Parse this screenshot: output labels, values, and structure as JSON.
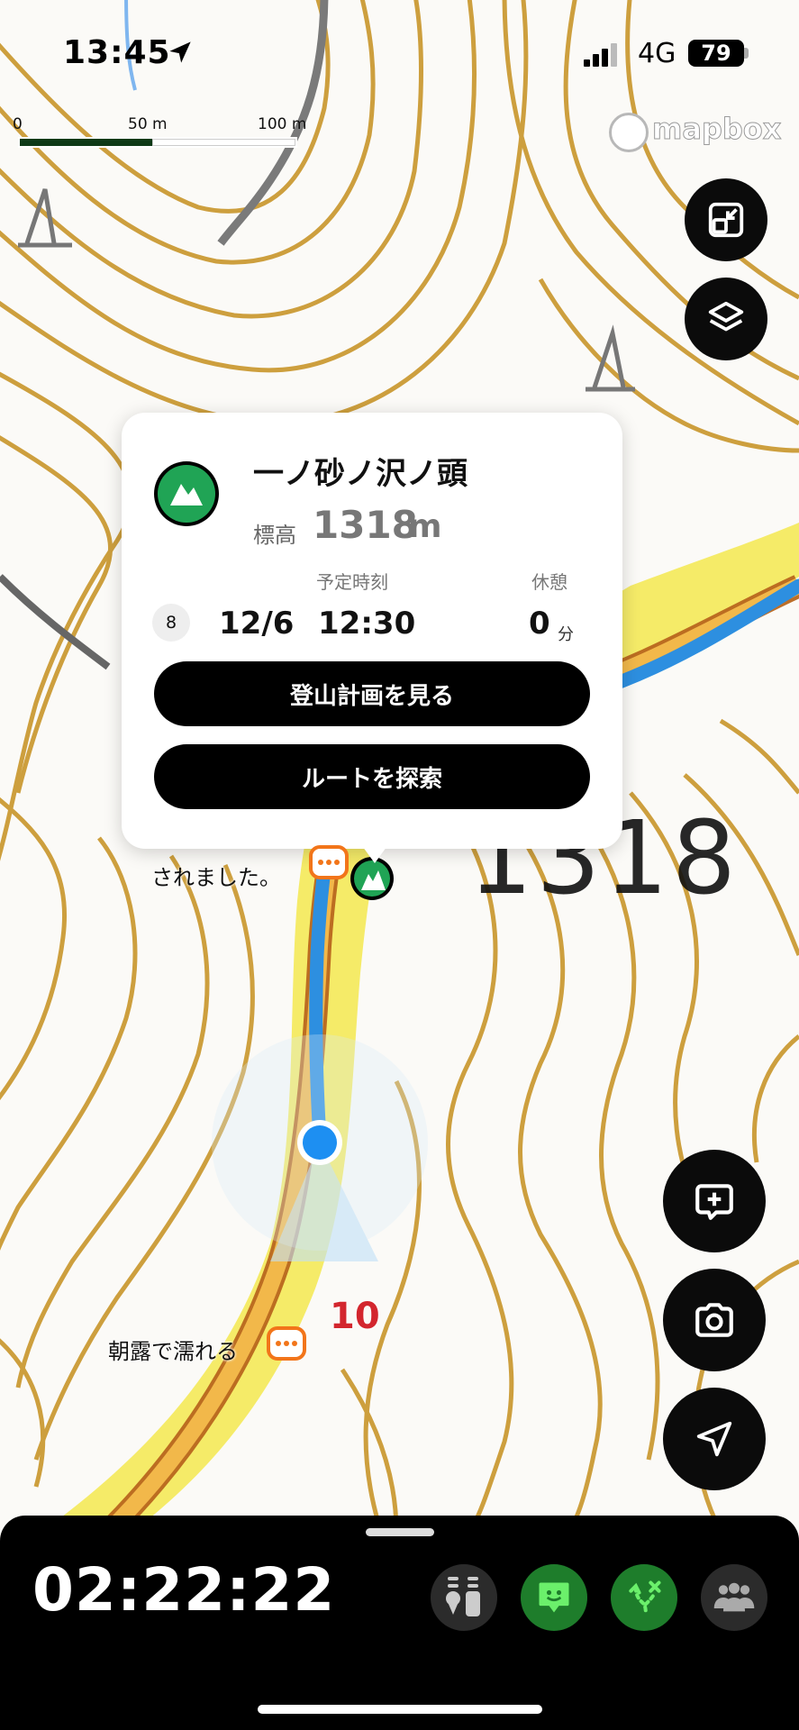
{
  "status_bar": {
    "time": "13:45",
    "network": "4G",
    "battery": "79"
  },
  "map": {
    "scale": {
      "label_0": "0",
      "label_50": "50 m",
      "label_100": "100 m"
    },
    "attribution": "mapbox",
    "contour_label": "1318",
    "route_marker_number": "10",
    "comments": [
      {
        "text": "されました。"
      },
      {
        "text": "朝露で濡れる"
      }
    ]
  },
  "popup": {
    "peak_name": "一ノ砂ノ沢ノ頭",
    "elevation_label": "標高",
    "elevation_value": "1318",
    "elevation_unit": "m",
    "schedule_header": "予定時刻",
    "rest_header": "休憩",
    "step_number": "8",
    "date": "12/6",
    "time": "12:30",
    "rest_value": "0",
    "rest_unit": "分",
    "view_plan_button": "登山計画を見る",
    "explore_route_button": "ルートを探索"
  },
  "bottom_panel": {
    "elapsed_time": "02:22:22"
  },
  "colors": {
    "contour": "#c9962a",
    "route_blue": "#2d8fe0",
    "highlight_yellow": "#f2e23a",
    "peak_green": "#20a455",
    "comment_orange": "#f2751a",
    "active_tool_green": "#1e7d2b"
  }
}
